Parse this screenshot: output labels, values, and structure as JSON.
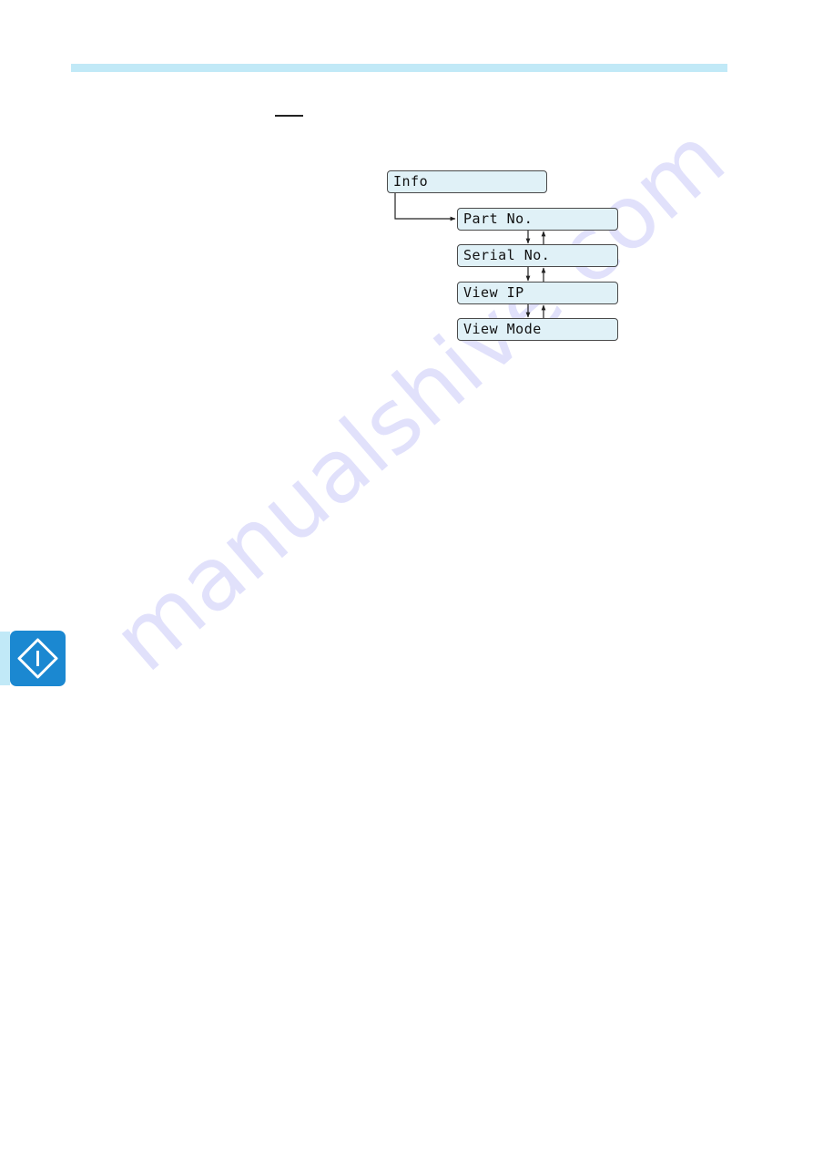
{
  "page": {
    "header_bar_color": "#c1e9f7",
    "watermark": "manualshive.com"
  },
  "menu_tree": {
    "root": {
      "label": "Info"
    },
    "children": [
      {
        "label": "Part No."
      },
      {
        "label": "Serial No."
      },
      {
        "label": "View IP"
      },
      {
        "label": "View Mode"
      }
    ],
    "box_fill_color": "#e0f1f7",
    "box_border_color": "#4a4a4a"
  },
  "side_tab": {
    "icon": "info-diamond-icon",
    "icon_bg_color": "#1b88d1",
    "strip_color": "#c1e9f7"
  }
}
